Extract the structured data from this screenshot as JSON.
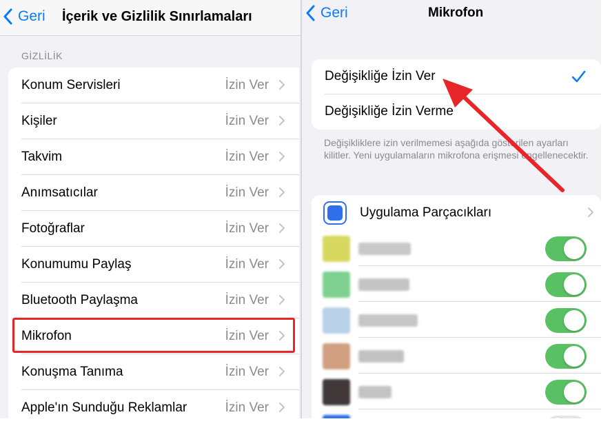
{
  "left": {
    "back_label": "Geri",
    "title": "İçerik ve Gizlilik Sınırlamaları",
    "section_header": "GİZLİLİK",
    "rows": [
      {
        "label": "Konum Servisleri",
        "value": "İzin Ver"
      },
      {
        "label": "Kişiler",
        "value": "İzin Ver"
      },
      {
        "label": "Takvim",
        "value": "İzin Ver"
      },
      {
        "label": "Anımsatıcılar",
        "value": "İzin Ver"
      },
      {
        "label": "Fotoğraflar",
        "value": "İzin Ver"
      },
      {
        "label": "Konumumu Paylaş",
        "value": "İzin Ver"
      },
      {
        "label": "Bluetooth Paylaşma",
        "value": "İzin Ver"
      },
      {
        "label": "Mikrofon",
        "value": "İzin Ver"
      },
      {
        "label": "Konuşma Tanıma",
        "value": "İzin Ver"
      },
      {
        "label": "Apple'ın Sunduğu Reklamlar",
        "value": "İzin Ver"
      }
    ],
    "highlighted_row": "Mikrofon"
  },
  "right": {
    "back_label": "Geri",
    "title": "Mikrofon",
    "options": [
      {
        "label": "Değişikliğe İzin Ver",
        "selected": true
      },
      {
        "label": "Değişikliğe İzin Verme",
        "selected": false
      }
    ],
    "footnote": "Değişikliklere izin verilmemesi aşağıda gösterilen ayarları kilitler. Yeni uygulamaların mikrofona erişmesi engellenecektir.",
    "widgets_label": "Uygulama Parçacıkları",
    "apps": [
      {
        "icon_color": "#d8d860",
        "name_color": "#c8c8c8",
        "toggle_on": true
      },
      {
        "icon_color": "#7fd090",
        "name_color": "#c4c4c4",
        "toggle_on": true
      },
      {
        "icon_color": "#b8d0e8",
        "name_color": "#c6c6c6",
        "toggle_on": true
      },
      {
        "icon_color": "#d0a080",
        "name_color": "#c2c2c2",
        "toggle_on": true
      },
      {
        "icon_color": "#403838",
        "name_color": "#c4c4c4",
        "toggle_on": true
      },
      {
        "icon_color": "#2f6fea",
        "name_color": "#c8c8c8",
        "toggle_on": false
      }
    ]
  },
  "colors": {
    "accent": "#0a7aff",
    "toggle_on": "#5ac064",
    "highlight": "#e8262a",
    "secondary_text": "#8a8a8e",
    "background": "#f2f2f6"
  },
  "icons": {
    "back": "chevron-left-icon",
    "disclosure": "chevron-right-icon",
    "selected": "checkmark-icon",
    "widgets": "widgets-icon",
    "annotation": "red-arrow"
  }
}
